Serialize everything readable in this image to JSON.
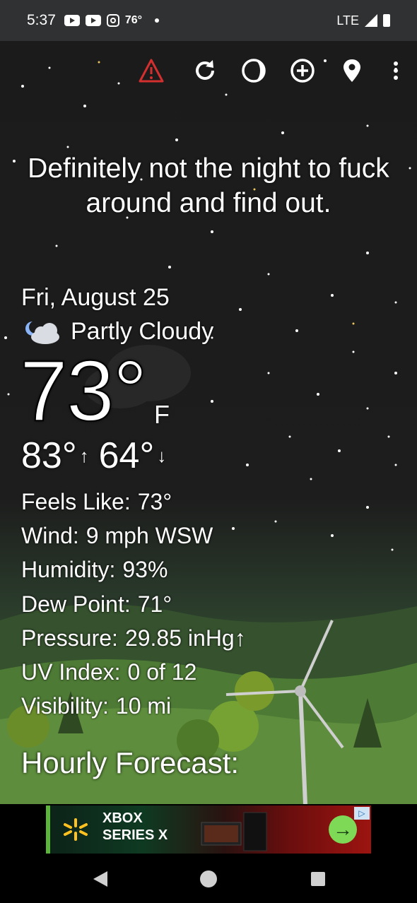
{
  "status_bar": {
    "time": "5:37",
    "temperature": "76°",
    "network": "LTE"
  },
  "toolbar": {
    "icons": [
      "warning-icon",
      "refresh-icon",
      "moon-phase-icon",
      "add-icon",
      "location-icon",
      "more-icon"
    ],
    "warning_color": "#d32f2f"
  },
  "quote": "Definitely not the night to fuck around and find out.",
  "weather": {
    "date": "Fri, August 25",
    "condition": "Partly Cloudy",
    "temperature": "73°",
    "unit": "F",
    "high": "83°",
    "low": "64°"
  },
  "details": [
    {
      "label": "Feels Like:",
      "value": "73°"
    },
    {
      "label": "Wind:",
      "value": "9 mph WSW"
    },
    {
      "label": "Humidity:",
      "value": "93%"
    },
    {
      "label": "Dew Point:",
      "value": "71°"
    },
    {
      "label": "Pressure:",
      "value": "29.85 inHg↑"
    },
    {
      "label": "UV Index:",
      "value": "0 of 12"
    },
    {
      "label": "Visibility:",
      "value": "10 mi"
    }
  ],
  "hourly_heading": "Hourly Forecast:",
  "ad": {
    "line1": "XBOX",
    "line2": "SERIES X",
    "accent": "#7ed957"
  }
}
